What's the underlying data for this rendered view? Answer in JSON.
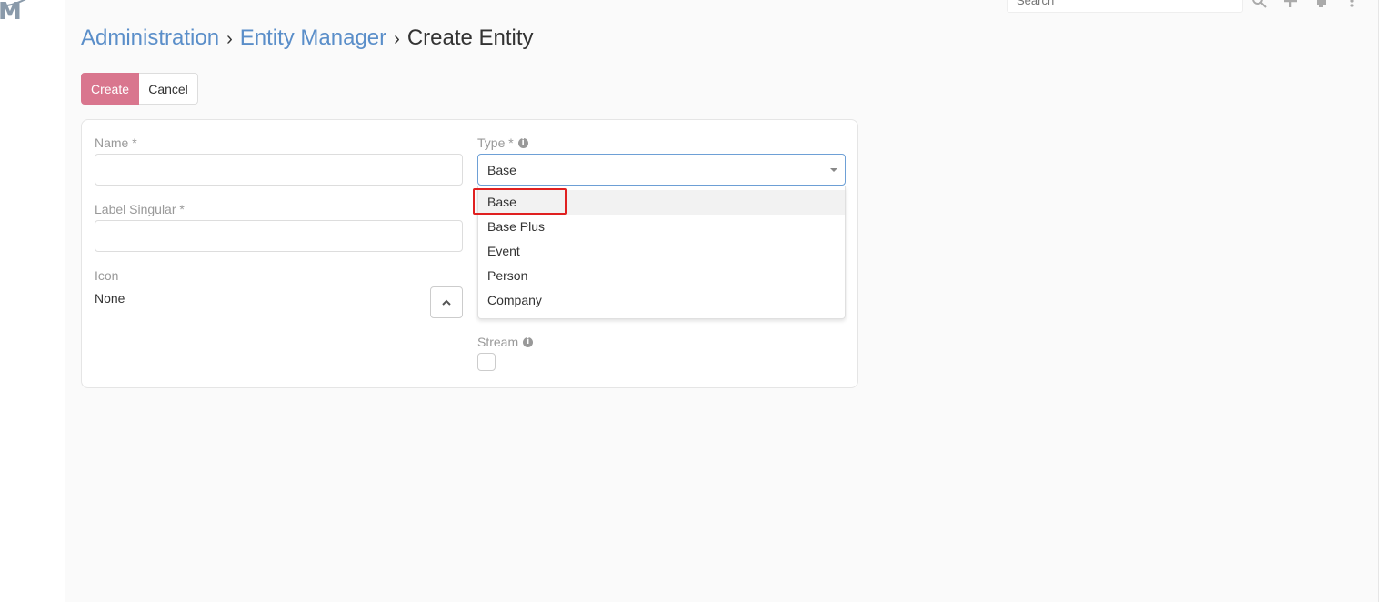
{
  "app": {
    "logo_text": "M"
  },
  "topbar": {
    "search_placeholder": "Search",
    "icons": [
      "search-icon",
      "plus-icon",
      "bell-icon",
      "kebab-menu-icon"
    ]
  },
  "breadcrumb": {
    "items": [
      "Administration",
      "Entity Manager"
    ],
    "current": "Create Entity",
    "separator": "›"
  },
  "actions": {
    "create_label": "Create",
    "cancel_label": "Cancel",
    "primary_color": "#d9768e"
  },
  "form": {
    "name_label": "Name *",
    "name_value": "",
    "label_singular_label": "Label Singular *",
    "label_singular_value": "",
    "icon_label": "Icon",
    "icon_value": "None",
    "type_label": "Type *",
    "type_value": "Base",
    "type_options": [
      "Base",
      "Base Plus",
      "Event",
      "Person",
      "Company"
    ],
    "stream_label": "Stream",
    "stream_checked": false
  }
}
